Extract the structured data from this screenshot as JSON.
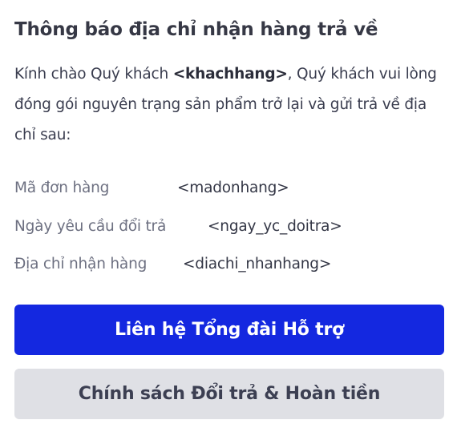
{
  "notice": {
    "title": "Thông báo địa chỉ nhận hàng trả về",
    "greeting_prefix": "Kính chào Quý khách ",
    "customer_placeholder": "<khachhang>",
    "greeting_suffix": ", Quý khách vui lòng đóng gói nguyên trạng sản phẩm trở lại và gửi trả về địa chỉ sau:"
  },
  "details": [
    {
      "label": "Mã đơn hàng",
      "value": "<madonhang>"
    },
    {
      "label": "Ngày yêu cầu đổi trả",
      "value": "<ngay_yc_doitra>"
    },
    {
      "label": "Địa chỉ nhận hàng",
      "value": "<diachi_nhanhang>"
    }
  ],
  "actions": {
    "contact_support": "Liên hệ Tổng đài Hỗ trợ",
    "return_policy": "Chính sách Đổi trả & Hoàn tiền"
  },
  "colors": {
    "primary_button": "#1428e0",
    "secondary_button": "#dfe0e5"
  }
}
